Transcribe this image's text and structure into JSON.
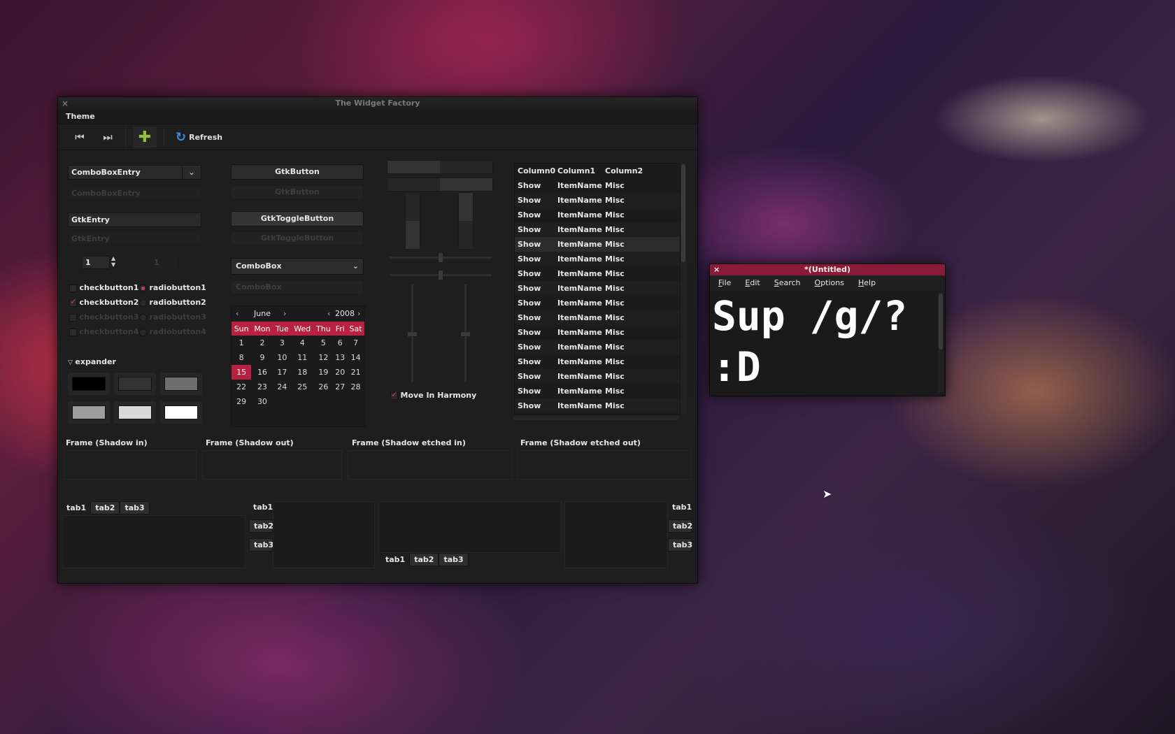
{
  "factory": {
    "title": "The Widget Factory",
    "close_glyph": "×",
    "menu": {
      "theme": "Theme"
    },
    "toolbar": {
      "refresh": "Refresh",
      "add_glyph": "✚",
      "first_glyph": "⏮",
      "last_glyph": "⏭",
      "refresh_glyph": "↻"
    },
    "left": {
      "combo_entry": "ComboBoxEntry",
      "combo_entry_disabled": "ComboBoxEntry",
      "entry": "GtkEntry",
      "entry_disabled": "GtkEntry",
      "spin_value": "1",
      "spin_value_disabled": "1",
      "checks": [
        "checkbutton1",
        "checkbutton2",
        "checkbutton3",
        "checkbutton4"
      ],
      "radios": [
        "radiobutton1",
        "radiobutton2",
        "radiobutton3",
        "radiobutton4"
      ],
      "expander": "expander"
    },
    "middle": {
      "button": "GtkButton",
      "button_disabled": "GtkButton",
      "toggle": "GtkToggleButton",
      "toggle_disabled": "GtkToggleButton",
      "combo": "ComboBox",
      "combo_disabled": "ComboBox",
      "calendar": {
        "month": "June",
        "year": "2008",
        "days": [
          "Sun",
          "Mon",
          "Tue",
          "Wed",
          "Thu",
          "Fri",
          "Sat"
        ],
        "weeks": [
          [
            "1",
            "2",
            "3",
            "4",
            "5",
            "6",
            "7"
          ],
          [
            "8",
            "9",
            "10",
            "11",
            "12",
            "13",
            "14"
          ],
          [
            "15",
            "16",
            "17",
            "18",
            "19",
            "20",
            "21"
          ],
          [
            "22",
            "23",
            "24",
            "25",
            "26",
            "27",
            "28"
          ],
          [
            "29",
            "30",
            "",
            "",
            "",
            "",
            ""
          ]
        ],
        "selected": "15"
      }
    },
    "harmony": "Move In Harmony",
    "tree": {
      "columns": [
        "Column0",
        "Column1",
        "Column2"
      ],
      "rows": [
        [
          "Show",
          "ItemName",
          "Misc"
        ],
        [
          "Show",
          "ItemName",
          "Misc"
        ],
        [
          "Show",
          "ItemName",
          "Misc"
        ],
        [
          "Show",
          "ItemName",
          "Misc"
        ],
        [
          "Show",
          "ItemName",
          "Misc"
        ],
        [
          "Show",
          "ItemName",
          "Misc"
        ],
        [
          "Show",
          "ItemName",
          "Misc"
        ],
        [
          "Show",
          "ItemName",
          "Misc"
        ],
        [
          "Show",
          "ItemName",
          "Misc"
        ],
        [
          "Show",
          "ItemName",
          "Misc"
        ],
        [
          "Show",
          "ItemName",
          "Misc"
        ],
        [
          "Show",
          "ItemName",
          "Misc"
        ],
        [
          "Show",
          "ItemName",
          "Misc"
        ],
        [
          "Show",
          "ItemName",
          "Misc"
        ],
        [
          "Show",
          "ItemName",
          "Misc"
        ],
        [
          "Show",
          "ItemName",
          "Misc"
        ]
      ]
    },
    "frames": [
      "Frame (Shadow in)",
      "Frame (Shadow out)",
      "Frame (Shadow etched in)",
      "Frame (Shadow etched out)"
    ],
    "tabs": [
      "tab1",
      "tab2",
      "tab3"
    ]
  },
  "editor": {
    "title": "*(Untitled)",
    "close_glyph": "×",
    "menu": [
      "File",
      "Edit",
      "Search",
      "Options",
      "Help"
    ],
    "line1": "Sup /g/?",
    "line2": ":D"
  },
  "colors": {
    "accent": "#b8213f",
    "add_icon": "#8fc43a",
    "refresh_icon": "#3d8ee0"
  }
}
